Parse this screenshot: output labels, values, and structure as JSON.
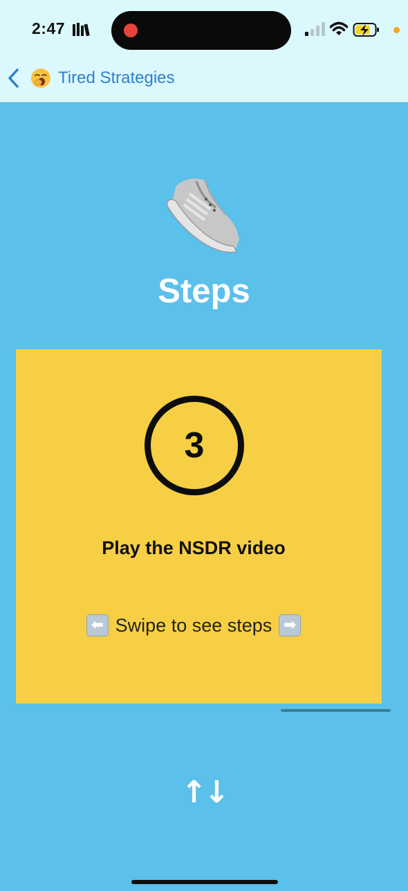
{
  "status_bar": {
    "time": "2:47",
    "icons": [
      "books-icon",
      "recording-dot-icon",
      "cellular-signal-icon",
      "wifi-icon",
      "battery-charging-icon",
      "privacy-dot-icon"
    ]
  },
  "nav": {
    "back_icon": "chevron-left-icon",
    "emoji": "yawning-face-icon",
    "title": "Tired Strategies"
  },
  "page": {
    "icon": "running-shoe-icon",
    "title": "Steps"
  },
  "card": {
    "step_number": "3",
    "step_text": "Play the NSDR video",
    "swipe_left_icon": "⬅",
    "swipe_text": "Swipe to see steps",
    "swipe_right_icon": "➡"
  },
  "controls": {
    "arrows": "↑↓"
  },
  "colors": {
    "background": "#5bc0ea",
    "header": "#dbf8fd",
    "card": "#f7cf45",
    "nav_link": "#2f7fd0"
  }
}
